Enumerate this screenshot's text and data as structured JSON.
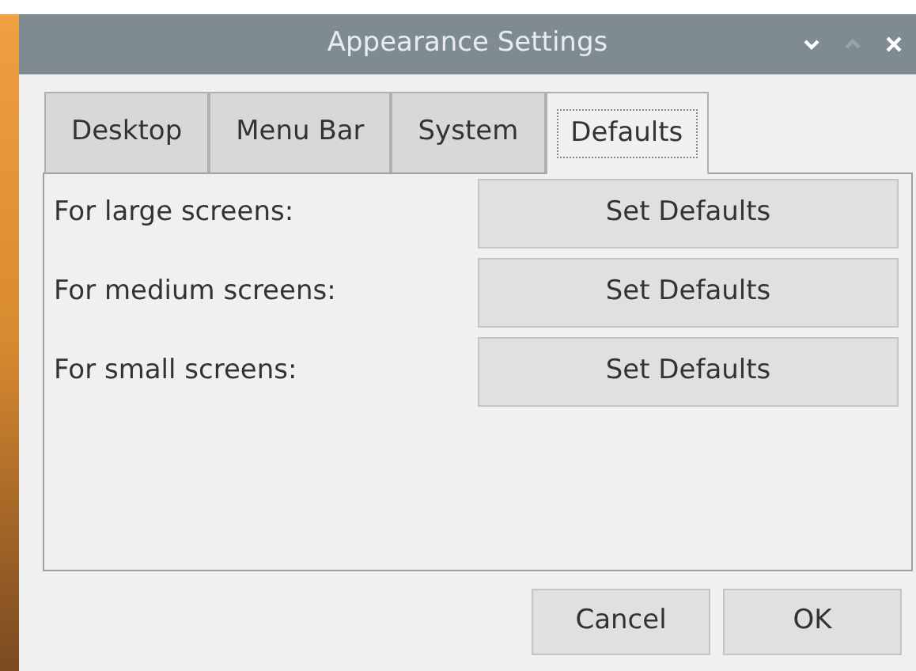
{
  "window": {
    "title": "Appearance Settings"
  },
  "tabs": [
    {
      "label": "Desktop",
      "selected": false
    },
    {
      "label": "Menu Bar",
      "selected": false
    },
    {
      "label": "System",
      "selected": false
    },
    {
      "label": "Defaults",
      "selected": true
    }
  ],
  "rows": [
    {
      "label": "For large screens:",
      "button": "Set Defaults"
    },
    {
      "label": "For medium screens:",
      "button": "Set Defaults"
    },
    {
      "label": "For small screens:",
      "button": "Set Defaults"
    }
  ],
  "buttons": [
    "Cancel",
    "OK"
  ]
}
